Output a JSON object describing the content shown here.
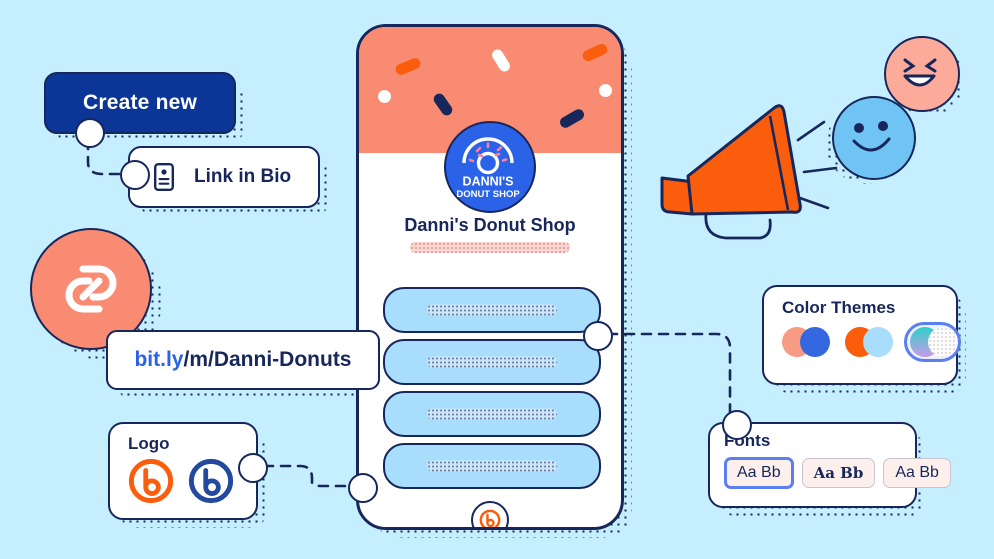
{
  "background_color": "#c5eefe",
  "palette": {
    "navy": "#17275b",
    "deep_blue": "#0b3697",
    "royal_blue": "#2a63e8",
    "orange": "#fa5d0b",
    "salmon": "#f98b73",
    "light_blue": "#a8ddfb",
    "sky_blue": "#6fc4f3",
    "pink": "#fcaa9a",
    "white": "#ffffff"
  },
  "create_new": {
    "label": "Create new",
    "icon": "none"
  },
  "link_in_bio": {
    "label": "Link in Bio",
    "icon": "bio-card-icon"
  },
  "url_pill": {
    "domain": "bit.ly",
    "path": "/m/Danni-Donuts",
    "full": "bit.ly/m/Danni-Donuts"
  },
  "link_circle": {
    "icon": "chain-link-icon",
    "color": "#f98b73"
  },
  "logo_card": {
    "title": "Logo",
    "options": [
      {
        "name": "bitly-logo-orange",
        "color": "#fa5d0b"
      },
      {
        "name": "bitly-logo-navy",
        "color": "#234a9e"
      }
    ]
  },
  "color_themes_card": {
    "title": "Color Themes",
    "swatches": [
      {
        "name": "theme-salmon-blue",
        "left": "#f89b84",
        "right": "#3567e0",
        "selected": false
      },
      {
        "name": "theme-orange-skyblue",
        "left": "#fa5d0b",
        "right": "#a8ddfb",
        "selected": false
      },
      {
        "name": "theme-gradient-white",
        "left": "#2fd0c8",
        "right": "#ffffff",
        "selected": true
      }
    ]
  },
  "fonts_card": {
    "title": "Fonts",
    "chips": [
      {
        "label": "Aa Bb",
        "style": "sans",
        "selected": true
      },
      {
        "label": "Aa Bb",
        "style": "serif-bold",
        "selected": false
      },
      {
        "label": "Aa Bb",
        "style": "sans",
        "selected": false
      }
    ]
  },
  "phone": {
    "shop_name": "Danni's Donut Shop",
    "logo": {
      "line1": "DANNI'S",
      "line2": "DONUT SHOP",
      "icon": "donut-icon"
    },
    "bio_placeholder": "",
    "links": [
      {
        "name": "link-button-1",
        "label": ""
      },
      {
        "name": "link-button-2",
        "label": ""
      },
      {
        "name": "link-button-3",
        "label": ""
      },
      {
        "name": "link-button-4",
        "label": ""
      }
    ],
    "footer_icon": "bitly-logo-icon"
  },
  "decorations": {
    "megaphone": {
      "name": "megaphone-icon",
      "color": "#fa5d0b"
    },
    "face_laughing": {
      "name": "laughing-face-icon",
      "color": "#fcaa9a"
    },
    "face_smiling": {
      "name": "smiling-face-icon",
      "color": "#6fc4f3"
    }
  }
}
